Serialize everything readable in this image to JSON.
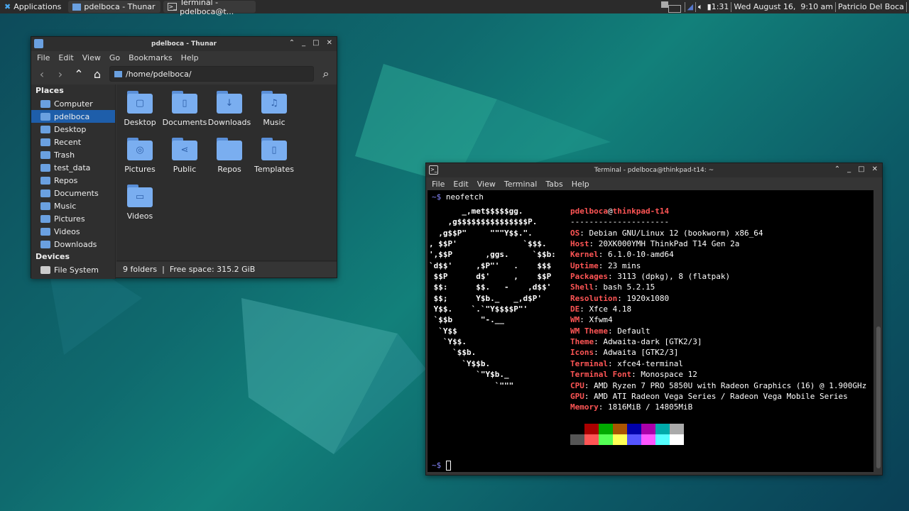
{
  "panel": {
    "apps": "Applications",
    "tasks": [
      "pdelboca - Thunar",
      "Terminal - pdelboca@t..."
    ],
    "battery": "1:31",
    "clock": "Wed August 16,  9:10 am",
    "user": "Patricio Del Boca"
  },
  "thunar": {
    "title": "pdelboca - Thunar",
    "menu": [
      "File",
      "Edit",
      "View",
      "Go",
      "Bookmarks",
      "Help"
    ],
    "location": "/home/pdelboca/",
    "places_header": "Places",
    "places": [
      "Computer",
      "pdelboca",
      "Desktop",
      "Recent",
      "Trash",
      "test_data",
      "Repos",
      "Documents",
      "Music",
      "Pictures",
      "Videos",
      "Downloads"
    ],
    "selected": "pdelboca",
    "devices_header": "Devices",
    "devices": [
      "File System"
    ],
    "items": [
      {
        "name": "Desktop",
        "glyph": "▢"
      },
      {
        "name": "Documents",
        "glyph": "▯"
      },
      {
        "name": "Downloads",
        "glyph": "↓"
      },
      {
        "name": "Music",
        "glyph": "♫"
      },
      {
        "name": "Pictures",
        "glyph": "◎"
      },
      {
        "name": "Public",
        "glyph": "⋖"
      },
      {
        "name": "Repos",
        "glyph": ""
      },
      {
        "name": "Templates",
        "glyph": "▯"
      },
      {
        "name": "Videos",
        "glyph": "▭"
      }
    ],
    "status": "9 folders  |  Free space: 315.2 GiB"
  },
  "terminal": {
    "title": "Terminal - pdelboca@thinkpad-t14: ~",
    "menu": [
      "File",
      "Edit",
      "View",
      "Terminal",
      "Tabs",
      "Help"
    ],
    "prompt": "~$ ",
    "command": "neofetch",
    "ascii": [
      "       _,met$$$$$gg.",
      "    ,g$$$$$$$$$$$$$$$P.",
      "  ,g$$P\"     \"\"\"Y$$.\".",
      ", $$P'              `$$$.",
      "',$$P       ,ggs.     `$$b:",
      "`d$$'     ,$P\"'   .    $$$",
      " $$P      d$'     ,    $$P",
      " $$:      $$.   -    ,d$$'",
      " $$;      Y$b._   _,d$P'",
      " Y$$.    `.`\"Y$$$$P\"'",
      " `$$b      \"-.__",
      "  `Y$$",
      "   `Y$$.",
      "     `$$b.",
      "       `Y$$b.",
      "          `\"Y$b._",
      "              `\"\"\""
    ],
    "user": "pdelboca",
    "host": "thinkpad-t14",
    "rule": "---------------------",
    "info": [
      {
        "k": "OS",
        "v": "Debian GNU/Linux 12 (bookworm) x86_64"
      },
      {
        "k": "Host",
        "v": "20XK000YMH ThinkPad T14 Gen 2a"
      },
      {
        "k": "Kernel",
        "v": "6.1.0-10-amd64"
      },
      {
        "k": "Uptime",
        "v": "23 mins"
      },
      {
        "k": "Packages",
        "v": "3113 (dpkg), 8 (flatpak)"
      },
      {
        "k": "Shell",
        "v": "bash 5.2.15"
      },
      {
        "k": "Resolution",
        "v": "1920x1080"
      },
      {
        "k": "DE",
        "v": "Xfce 4.18"
      },
      {
        "k": "WM",
        "v": "Xfwm4"
      },
      {
        "k": "WM Theme",
        "v": "Default"
      },
      {
        "k": "Theme",
        "v": "Adwaita-dark [GTK2/3]"
      },
      {
        "k": "Icons",
        "v": "Adwaita [GTK2/3]"
      },
      {
        "k": "Terminal",
        "v": "xfce4-terminal"
      },
      {
        "k": "Terminal Font",
        "v": "Monospace 12"
      },
      {
        "k": "CPU",
        "v": "AMD Ryzen 7 PRO 5850U with Radeon Graphics (16) @ 1.900GHz"
      },
      {
        "k": "GPU",
        "v": "AMD ATI Radeon Vega Series / Radeon Vega Mobile Series"
      },
      {
        "k": "Memory",
        "v": "1816MiB / 14805MiB"
      }
    ],
    "palette1": [
      "#000000",
      "#aa0000",
      "#00aa00",
      "#aa5500",
      "#0000aa",
      "#aa00aa",
      "#00aaaa",
      "#aaaaaa"
    ],
    "palette2": [
      "#555555",
      "#ff5555",
      "#55ff55",
      "#ffff55",
      "#5555ff",
      "#ff55ff",
      "#55ffff",
      "#ffffff"
    ],
    "prompt2": "~$ "
  }
}
